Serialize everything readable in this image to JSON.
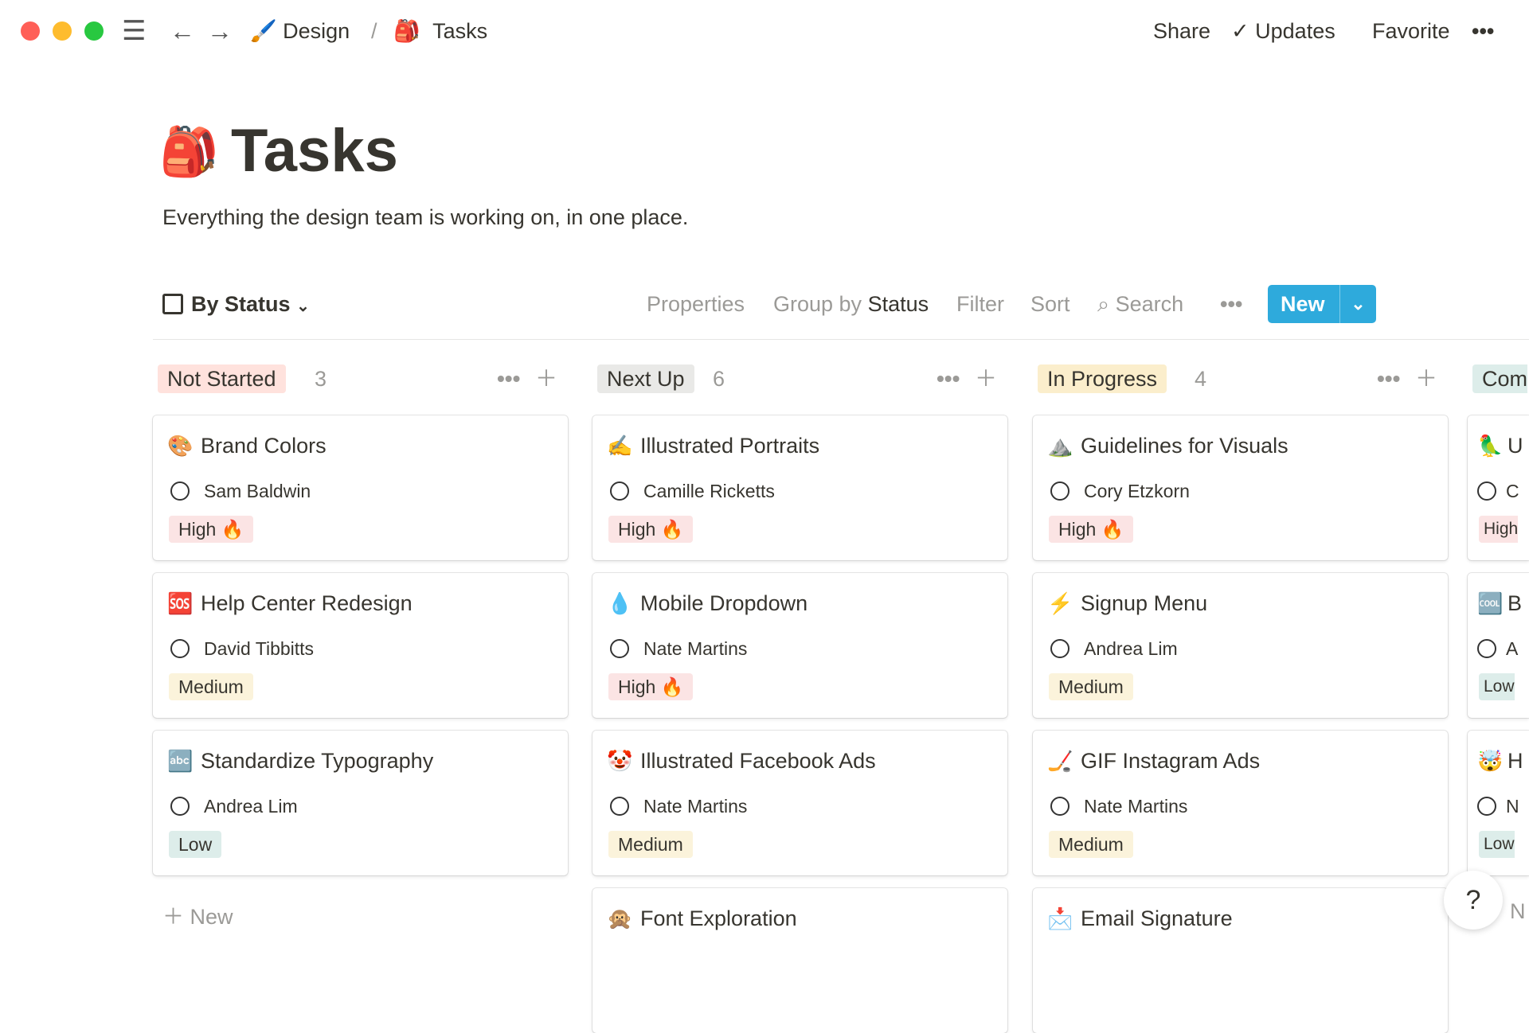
{
  "window": {
    "controls": {
      "close": "#ff5f57",
      "minimize": "#febc2e",
      "maximize": "#28c840"
    }
  },
  "breadcrumb": [
    {
      "icon": "🖌️",
      "label": "Design"
    },
    {
      "icon": "🎒",
      "label": "Tasks"
    }
  ],
  "breadcrumb_sep": "/",
  "topbar": {
    "share": "Share",
    "updates": "Updates",
    "favorite": "Favorite",
    "more": "•••"
  },
  "page": {
    "icon": "🎒",
    "title": "Tasks",
    "description": "Everything the design team is working on, in one place."
  },
  "toolbar": {
    "view": "By Status",
    "properties": "Properties",
    "group_by": "Group by",
    "group_value": "Status",
    "filter": "Filter",
    "sort": "Sort",
    "search": "Search",
    "more": "•••",
    "new": "New"
  },
  "colors": {
    "accent": "#2eaadc",
    "high": "#fbe4e4",
    "medium": "#fbf3db",
    "low": "#ddedea"
  },
  "columns": [
    {
      "status": "Not Started",
      "color": "#ffe2dd",
      "count": "3",
      "cards": [
        {
          "icon": "🎨",
          "title": "Brand Colors",
          "person": "Sam Baldwin",
          "priority": "High 🔥",
          "level": "high"
        },
        {
          "icon": "🆘",
          "title": "Help Center Redesign",
          "person": "David Tibbitts",
          "priority": "Medium",
          "level": "medium"
        },
        {
          "icon": "🔤",
          "title": "Standardize Typography",
          "person": "Andrea Lim",
          "priority": "Low",
          "level": "low"
        }
      ]
    },
    {
      "status": "Next Up",
      "color": "#e9e9e7",
      "count": "6",
      "cards": [
        {
          "icon": "✍️",
          "title": "Illustrated Portraits",
          "person": "Camille Ricketts",
          "priority": "High 🔥",
          "level": "high"
        },
        {
          "icon": "💧",
          "title": "Mobile Dropdown",
          "person": "Nate Martins",
          "priority": "High 🔥",
          "level": "high"
        },
        {
          "icon": "🤡",
          "title": "Illustrated Facebook Ads",
          "person": "Nate Martins",
          "priority": "Medium",
          "level": "medium"
        },
        {
          "icon": "🙊",
          "title": "Font Exploration"
        }
      ]
    },
    {
      "status": "In Progress",
      "color": "#fbeecc",
      "count": "4",
      "cards": [
        {
          "icon": "⛰️",
          "title": "Guidelines for Visuals",
          "person": "Cory Etzkorn",
          "priority": "High 🔥",
          "level": "high"
        },
        {
          "icon": "⚡",
          "title": "Signup Menu",
          "person": "Andrea Lim",
          "priority": "Medium",
          "level": "medium"
        },
        {
          "icon": "🏒",
          "title": "GIF Instagram Ads",
          "person": "Nate Martins",
          "priority": "Medium",
          "level": "medium"
        },
        {
          "icon": "📩",
          "title": "Email Signature"
        }
      ]
    },
    {
      "status": "Com",
      "color": "#ddedea",
      "cards": [
        {
          "icon": "🦜",
          "title": "U",
          "person": "C",
          "priority": "High",
          "level": "high"
        },
        {
          "icon": "🆒",
          "title": "B",
          "person": "A",
          "priority": "Low",
          "level": "low"
        },
        {
          "icon": "🤯",
          "title": "H",
          "person": "N",
          "priority": "Low",
          "level": "low"
        }
      ]
    }
  ],
  "add_new": "New",
  "column4_new": "N",
  "help": "?"
}
